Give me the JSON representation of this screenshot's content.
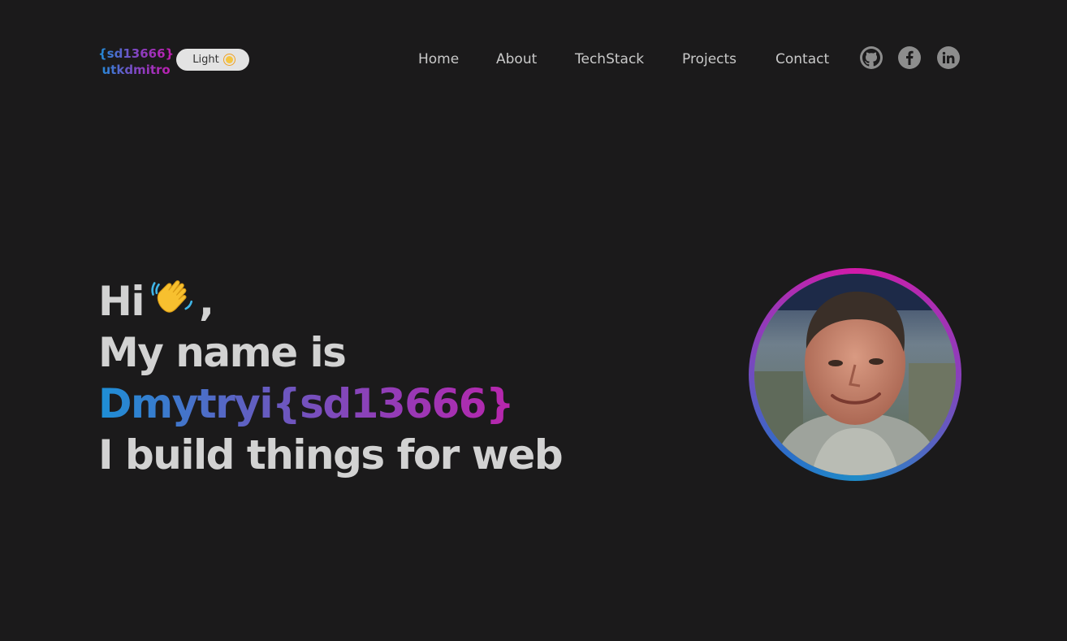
{
  "header": {
    "logo_line1": "{sd13666}",
    "logo_line2": "utkdmitro",
    "theme_toggle_label": "Light"
  },
  "nav": {
    "items": [
      "Home",
      "About",
      "TechStack",
      "Projects",
      "Contact"
    ]
  },
  "social": {
    "icons": [
      "github-icon",
      "facebook-icon",
      "linkedin-icon"
    ]
  },
  "hero": {
    "greeting": "Hi",
    "comma": ",",
    "line2": "My name is",
    "name": "Dmytryi{sd13666}",
    "line4": "I build things for web"
  },
  "colors": {
    "background": "#1b1a1b",
    "text": "#d2d2d2",
    "gradient_start": "#1d8fd6",
    "gradient_end": "#c71ca8"
  }
}
